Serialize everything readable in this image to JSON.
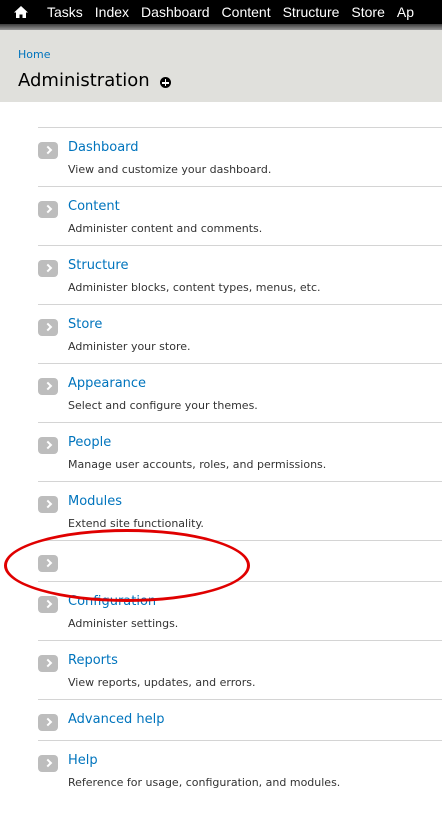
{
  "toolbar": {
    "home_icon": "home-icon",
    "items": [
      "Tasks",
      "Index",
      "Dashboard",
      "Content",
      "Structure",
      "Store",
      "Ap"
    ]
  },
  "breadcrumb": "Home",
  "page_title": "Administration",
  "items": [
    {
      "name": "Dashboard",
      "description": "View and customize your dashboard."
    },
    {
      "name": "Content",
      "description": "Administer content and comments."
    },
    {
      "name": "Structure",
      "description": "Administer blocks, content types, menus, etc."
    },
    {
      "name": "Store",
      "description": "Administer your store."
    },
    {
      "name": "Appearance",
      "description": "Select and configure your themes."
    },
    {
      "name": "People",
      "description": "Manage user accounts, roles, and permissions."
    },
    {
      "name": "Modules",
      "description": "Extend site functionality."
    },
    {
      "name": "",
      "description": ""
    },
    {
      "name": "Configuration",
      "description": "Administer settings."
    },
    {
      "name": "Reports",
      "description": "View reports, updates, and errors."
    },
    {
      "name": "Advanced help",
      "description": ""
    },
    {
      "name": "Help",
      "description": "Reference for usage, configuration, and modules."
    }
  ],
  "colors": {
    "link": "#0074bd",
    "annotation": "#e00000",
    "header_bg": "#e0e0dc"
  }
}
